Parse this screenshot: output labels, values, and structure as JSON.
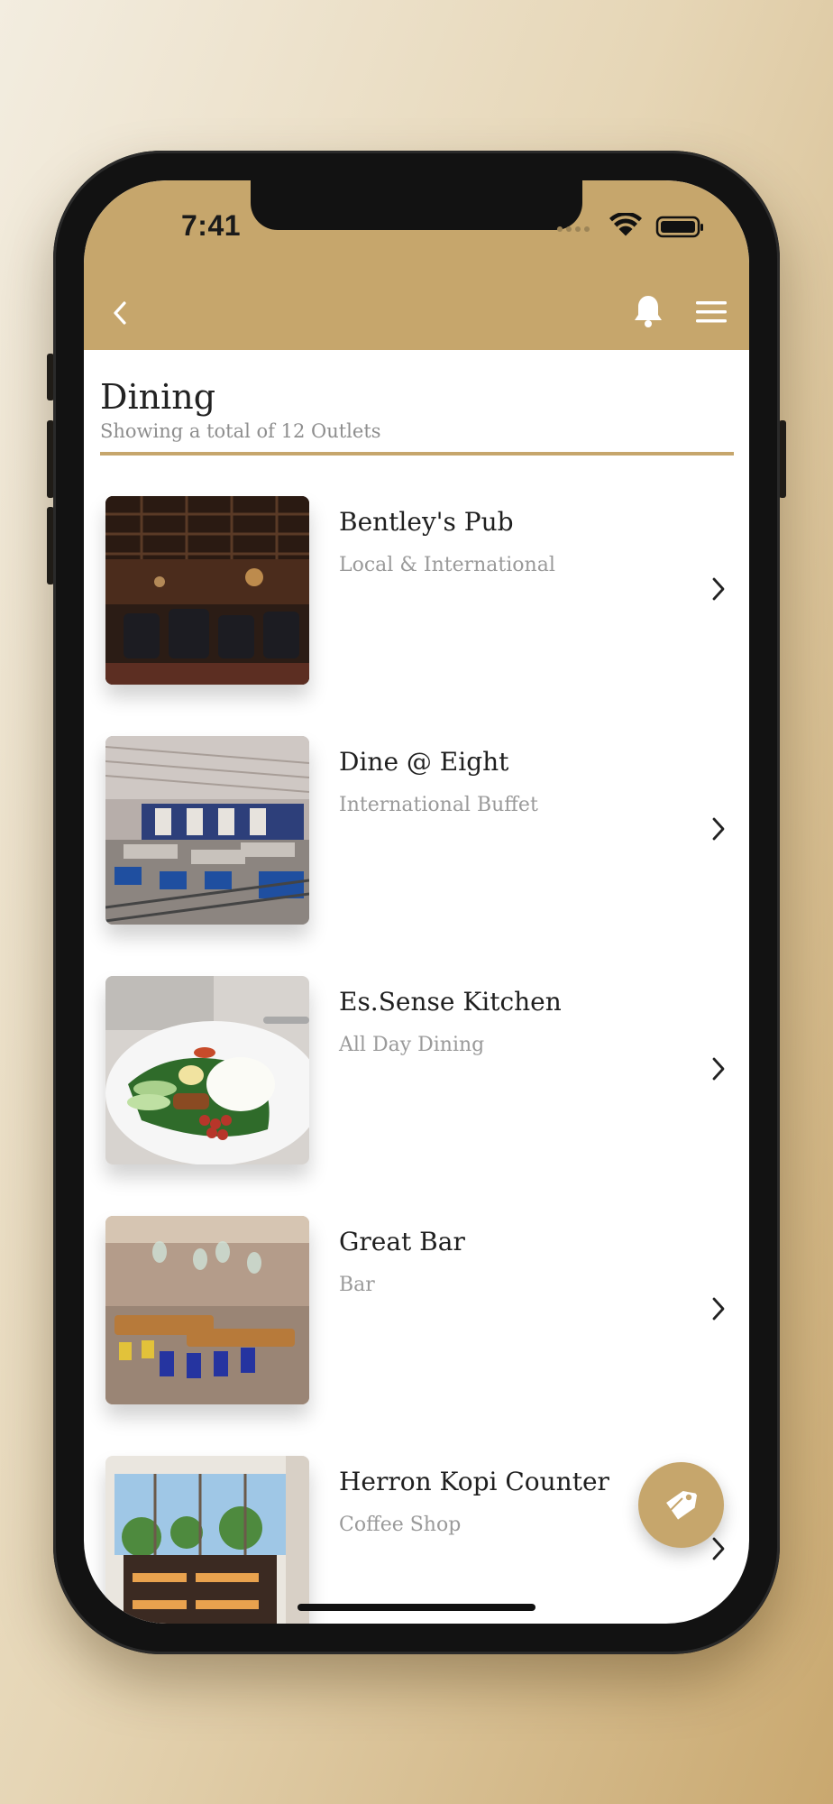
{
  "status": {
    "time": "7:41"
  },
  "header": {
    "back_icon": "chevron-left-icon",
    "bell_icon": "bell-icon",
    "menu_icon": "hamburger-menu-icon"
  },
  "page": {
    "title": "Dining",
    "subtitle": "Showing a total of 12 Outlets"
  },
  "outlets": [
    {
      "name": "Bentley's Pub",
      "cuisine": "Local & International",
      "image": "dark-pub-interior-photo"
    },
    {
      "name": "Dine @ Eight",
      "cuisine": "International Buffet",
      "image": "buffet-restaurant-interior-photo"
    },
    {
      "name": "Es.Sense Kitchen",
      "cuisine": "All Day Dining",
      "image": "nasi-lemak-plate-photo"
    },
    {
      "name": "Great Bar",
      "cuisine": "Bar",
      "image": "bar-with-blue-chairs-photo"
    },
    {
      "name": "Herron Kopi Counter",
      "cuisine": "Coffee Shop",
      "image": "coffee-shop-counter-photo"
    }
  ],
  "fab": {
    "icon": "price-tag-icon"
  },
  "colors": {
    "accent": "#c6a66c",
    "text": "#1f1f1f",
    "muted": "#9a9a9a"
  }
}
